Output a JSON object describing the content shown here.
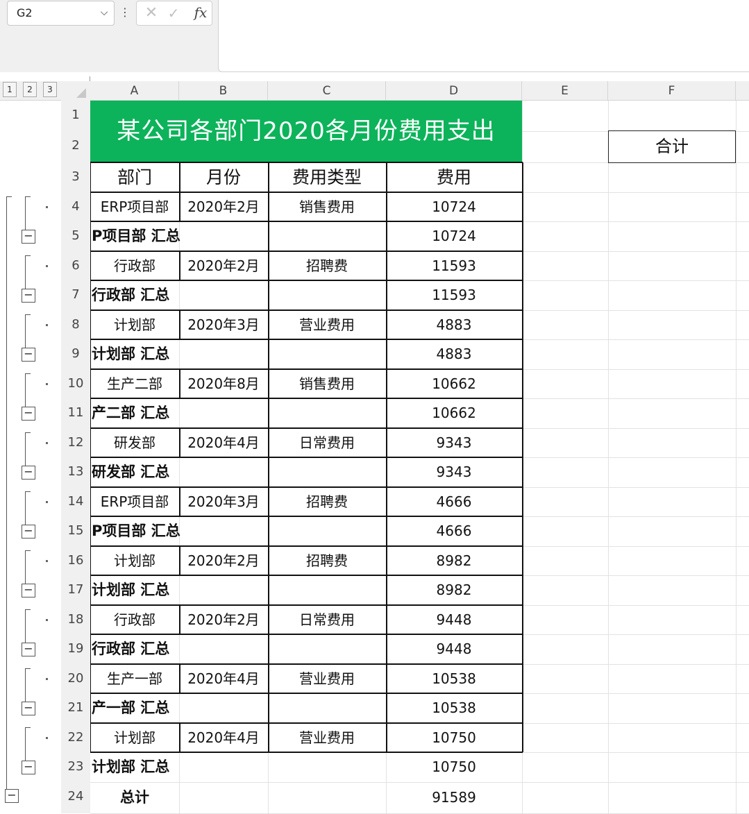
{
  "formula_bar": {
    "name_box": "G2",
    "cancel_icon": "close-icon",
    "enter_icon": "check-icon",
    "fx_label": "fx",
    "separator": "⋮",
    "value": ""
  },
  "outline_levels": [
    "1",
    "2",
    "3"
  ],
  "columns": [
    "A",
    "B",
    "C",
    "D",
    "E",
    "F"
  ],
  "rows": [
    "1",
    "2",
    "3",
    "4",
    "5",
    "6",
    "7",
    "8",
    "9",
    "10",
    "11",
    "12",
    "13",
    "14",
    "15",
    "16",
    "17",
    "18",
    "19",
    "20",
    "21",
    "22",
    "23",
    "24"
  ],
  "sheet": {
    "title": "某公司各部门2020各月份费用支出",
    "headers": [
      "部门",
      "月份",
      "费用类型",
      "费用"
    ],
    "total_label": "合计",
    "grand_total_label": "总计",
    "grand_total_value": "91589",
    "records": [
      {
        "dept": "ERP项目部",
        "month": "2020年2月",
        "type": "销售费用",
        "cost": "10724",
        "subtotal_label": "P项目部 汇总",
        "subtotal": "10724"
      },
      {
        "dept": "行政部",
        "month": "2020年2月",
        "type": "招聘费",
        "cost": "11593",
        "subtotal_label": "行政部 汇总",
        "subtotal": "11593"
      },
      {
        "dept": "计划部",
        "month": "2020年3月",
        "type": "营业费用",
        "cost": "4883",
        "subtotal_label": "计划部 汇总",
        "subtotal": "4883"
      },
      {
        "dept": "生产二部",
        "month": "2020年8月",
        "type": "销售费用",
        "cost": "10662",
        "subtotal_label": "产二部 汇总",
        "subtotal": "10662"
      },
      {
        "dept": "研发部",
        "month": "2020年4月",
        "type": "日常费用",
        "cost": "9343",
        "subtotal_label": "研发部 汇总",
        "subtotal": "9343"
      },
      {
        "dept": "ERP项目部",
        "month": "2020年3月",
        "type": "招聘费",
        "cost": "4666",
        "subtotal_label": "P项目部 汇总",
        "subtotal": "4666"
      },
      {
        "dept": "计划部",
        "month": "2020年2月",
        "type": "招聘费",
        "cost": "8982",
        "subtotal_label": "计划部 汇总",
        "subtotal": "8982"
      },
      {
        "dept": "行政部",
        "month": "2020年2月",
        "type": "日常费用",
        "cost": "9448",
        "subtotal_label": "行政部 汇总",
        "subtotal": "9448"
      },
      {
        "dept": "生产一部",
        "month": "2020年4月",
        "type": "营业费用",
        "cost": "10538",
        "subtotal_label": "产一部 汇总",
        "subtotal": "10538"
      },
      {
        "dept": "计划部",
        "month": "2020年4月",
        "type": "营业费用",
        "cost": "10750",
        "subtotal_label": "计划部 汇总",
        "subtotal": "10750"
      }
    ]
  },
  "colors": {
    "title_fill": "#0cb35a",
    "grid": "#e2e2e2",
    "header_bg": "#f0f0f0"
  }
}
